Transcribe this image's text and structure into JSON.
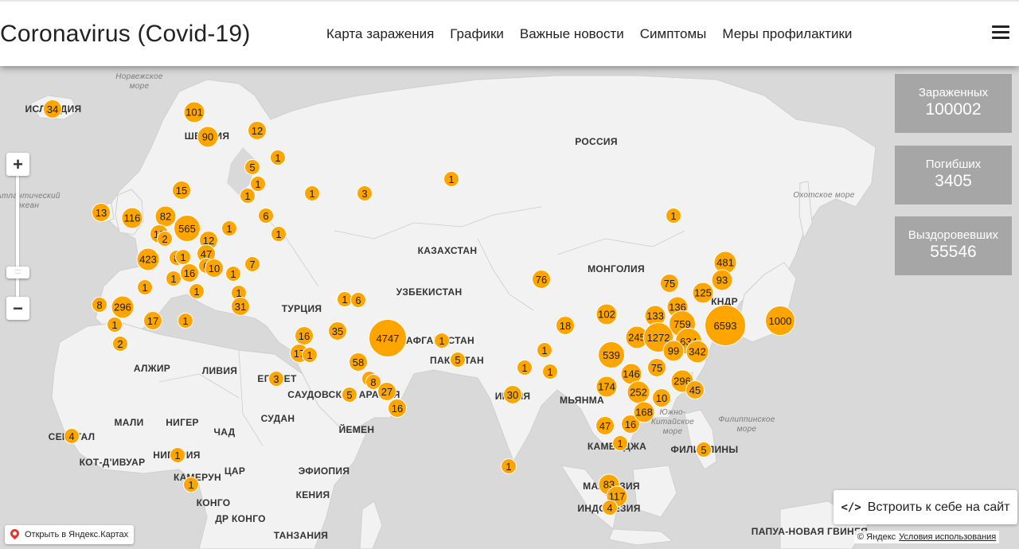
{
  "header": {
    "title": "Coronavirus (Covid-19)",
    "nav": [
      "Карта заражения",
      "Графики",
      "Важные новости",
      "Симптомы",
      "Меры профилактики"
    ]
  },
  "stats": [
    {
      "label": "Зараженных",
      "value": "100002"
    },
    {
      "label": "Погибших",
      "value": "3405"
    },
    {
      "label": "Выздоровевших",
      "value": "55546"
    }
  ],
  "map": {
    "zoom_in": "+",
    "zoom_out": "−",
    "embed_label": "Встроить к себе на сайт",
    "open_label": "Открыть в Яндекс.Картах",
    "copyright": "© Яндекс",
    "terms": "Условия использования",
    "colors": {
      "marker": "#ffa500",
      "land": "#f2f2f2",
      "water": "#d9d9d9",
      "panel": "#a6a6a6"
    },
    "labels": [
      {
        "text": "РОССИЯ",
        "bold": true
      },
      {
        "text": "КАЗАХСТАН",
        "bold": true
      },
      {
        "text": "МОНГОЛИЯ",
        "bold": true
      },
      {
        "text": "ТУРЦИЯ",
        "bold": true
      },
      {
        "text": "УЗБЕКИСТАН",
        "bold": true
      },
      {
        "text": "АФГАНИСТАН",
        "bold": true
      },
      {
        "text": "ПАКИСТАН",
        "bold": true
      },
      {
        "text": "ИНДИЯ",
        "bold": true
      },
      {
        "text": "МЬЯНМА",
        "bold": true
      },
      {
        "text": "АЛЖИР",
        "bold": true
      },
      {
        "text": "ЛИВИЯ",
        "bold": true
      },
      {
        "text": "ЕГИПЕТ",
        "bold": true
      },
      {
        "text": "САУДОВСКАЯ АРАВИЯ",
        "bold": true
      },
      {
        "text": "ЙЕМЕН",
        "bold": true
      },
      {
        "text": "МАЛИ",
        "bold": true
      },
      {
        "text": "НИГЕР",
        "bold": true
      },
      {
        "text": "ЧАД",
        "bold": true
      },
      {
        "text": "СУДАН",
        "bold": true
      },
      {
        "text": "НИГЕРИЯ",
        "bold": true
      },
      {
        "text": "ЭФИОПИЯ",
        "bold": true
      },
      {
        "text": "ЦАР",
        "bold": true
      },
      {
        "text": "КАМЕРУН",
        "bold": true
      },
      {
        "text": "КОНГО",
        "bold": true
      },
      {
        "text": "ДР КОНГО",
        "bold": true
      },
      {
        "text": "КЕНИЯ",
        "bold": true
      },
      {
        "text": "ТАНЗАНИЯ",
        "bold": true
      },
      {
        "text": "КОТ-Д'ИВУАР",
        "bold": true
      },
      {
        "text": "СЕНЕГАЛ",
        "bold": true
      },
      {
        "text": "ИНДОНЕЗИЯ",
        "bold": true
      },
      {
        "text": "МАЛАЙЗИЯ",
        "bold": true
      },
      {
        "text": "КАМБОДЖА",
        "bold": true
      },
      {
        "text": "ФИЛИППИНЫ",
        "bold": true
      },
      {
        "text": "КНДР",
        "bold": true
      },
      {
        "text": "ПАПУА-НОВАЯ ГВИНЕЯ",
        "bold": true
      },
      {
        "text": "ИСЛАНДИЯ",
        "bold": true
      },
      {
        "text": "ШВЕЦИЯ",
        "bold": true
      },
      {
        "text": "Норвежское море",
        "sea": true
      },
      {
        "text": "Охотское море",
        "sea": true
      },
      {
        "text": "Филиппинское море",
        "sea": true
      },
      {
        "text": "Южно-Китайское море",
        "sea": true
      },
      {
        "text": "Атлантический океан",
        "sea": true
      }
    ],
    "markers": [
      34,
      101,
      90,
      12,
      5,
      1,
      1,
      1,
      1,
      3,
      1,
      15,
      13,
      116,
      82,
      10,
      2,
      565,
      1,
      12,
      47,
      6,
      1,
      423,
      8,
      1,
      16,
      6,
      10,
      1,
      7,
      1,
      1,
      1,
      1,
      31,
      1,
      8,
      296,
      1,
      17,
      1,
      2,
      16,
      17,
      1,
      35,
      1,
      6,
      4747,
      1,
      58,
      4,
      8,
      27,
      5,
      16,
      3,
      5,
      76,
      18,
      1,
      1,
      1,
      30,
      1,
      102,
      539,
      245,
      146,
      174,
      252,
      16,
      47,
      1,
      168,
      133,
      75,
      136,
      759,
      1272,
      634,
      99,
      342,
      75,
      296,
      10,
      45,
      481,
      93,
      125,
      6593,
      1000,
      1,
      5,
      83,
      117,
      4,
      4,
      1,
      1
    ]
  }
}
